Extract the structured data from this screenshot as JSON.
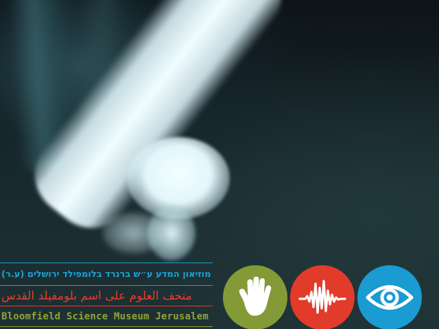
{
  "museum": {
    "name_he": "מוזיאון המדע ע״ש ברנרד בלומפילד ירושלים (ע.ר)",
    "name_ar": "متحف العلوم على اسم بلومفيلد القدس",
    "name_en": "Bloomfield Science Museum Jerusalem"
  },
  "icons": [
    {
      "name": "hand-icon",
      "color": "#849a37"
    },
    {
      "name": "sound-wave-icon",
      "color": "#e23b2a"
    },
    {
      "name": "eye-icon",
      "color": "#1a9bd1"
    }
  ],
  "colors": {
    "hebrew_text": "#1aa3d4",
    "arabic_text": "#e53e2c",
    "english_text": "#8aa63a"
  }
}
